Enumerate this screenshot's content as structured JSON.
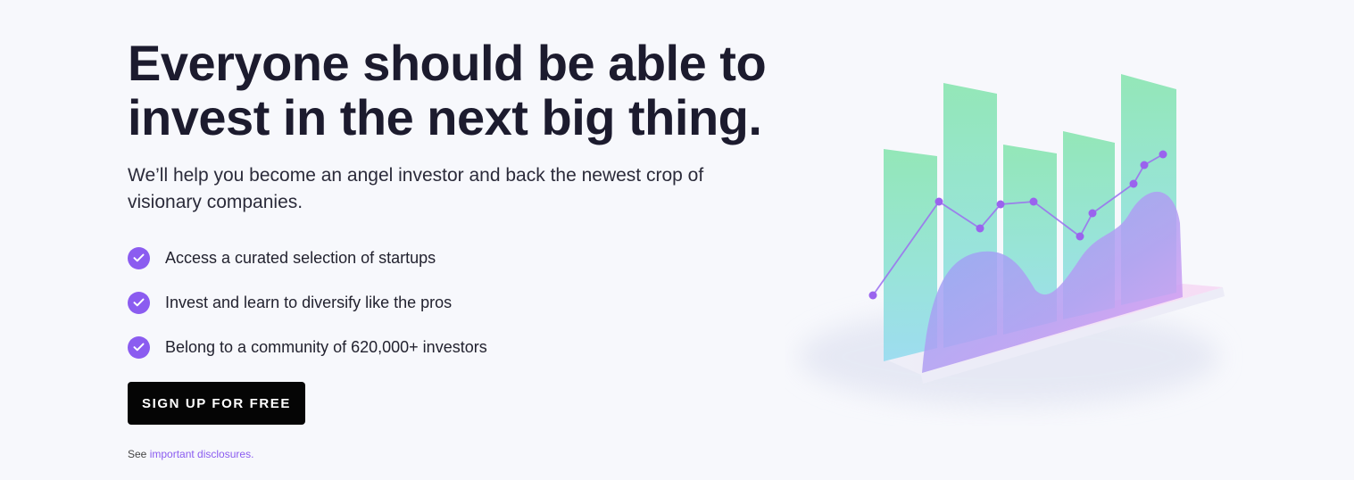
{
  "hero": {
    "headline_line1": "Everyone should be able to",
    "headline_line2": "invest in the next big thing.",
    "subhead": "We’ll help you become an angel investor and back the newest crop of visionary companies.",
    "features": [
      "Access a curated selection of startups",
      "Invest and learn to diversify like the pros",
      "Belong to a community of 620,000+ investors"
    ],
    "cta_label": "SIGN UP FOR FREE",
    "disclosure_prefix": "See ",
    "disclosure_link": "important disclosures."
  },
  "colors": {
    "accent": "#8b5cf0",
    "cta_bg": "#050505",
    "headline": "#1c1b2e",
    "background": "#f7f8fc"
  },
  "icons": {
    "feature_bullet": "check-circle-icon",
    "illustration": "chart-illustration"
  }
}
